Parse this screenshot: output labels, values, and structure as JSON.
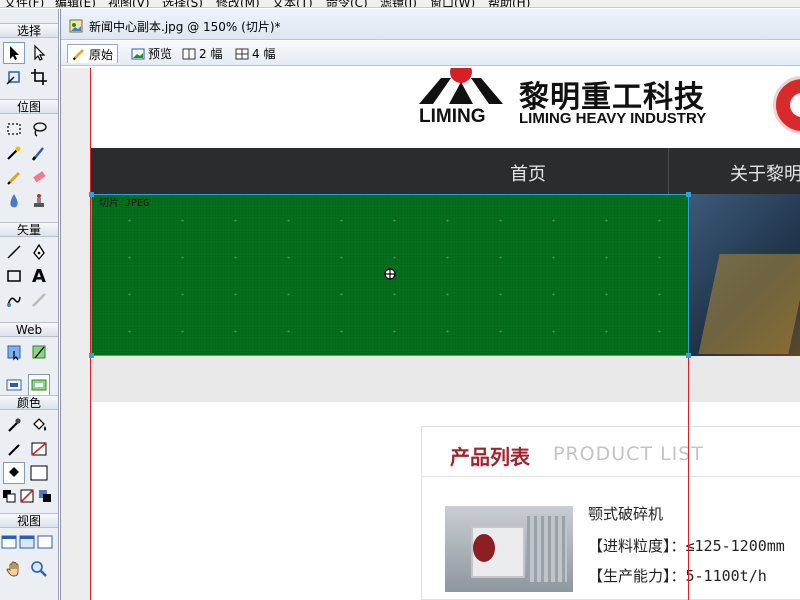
{
  "menubar": {
    "items": [
      "文件(F)",
      "编辑(E)",
      "视图(V)",
      "选择(S)",
      "修改(M)",
      "文本(T)",
      "命令(C)",
      "滤镜(I)",
      "窗口(W)",
      "帮助(H)"
    ]
  },
  "tools": {
    "sections": {
      "select": "选择",
      "bitmap": "位图",
      "vector": "矢量",
      "web": "Web",
      "colors": "颜色",
      "view": "视图"
    },
    "text_tool_glyph": "A"
  },
  "document": {
    "title": "新闻中心副本.jpg @ 150% (切片)*",
    "view_tabs": {
      "original": "原始",
      "preview": "预览",
      "two_up": "2 幅",
      "four_up": "4 幅"
    }
  },
  "site": {
    "logo_en": "LIMING",
    "logo_cn": "黎明重工科技",
    "logo_cn_en": "LIMING HEAVY INDUSTRY",
    "nav": [
      "首页",
      "关于黎明"
    ],
    "product": {
      "title": "产品列表",
      "title_en": "PRODUCT LIST",
      "name": "颚式破碎机",
      "line1": "【进料粒度】：≤125-1200mm",
      "line2": "【生产能力】：5-1100t/h"
    }
  },
  "slice": {
    "label": "切片  JPEG"
  },
  "colors": {
    "slice_fill": "#00781a",
    "slice_border": "#2aa2e0",
    "guide": "#e02020",
    "nav_bg": "#2a2c2e",
    "product_title": "#a3232a"
  }
}
